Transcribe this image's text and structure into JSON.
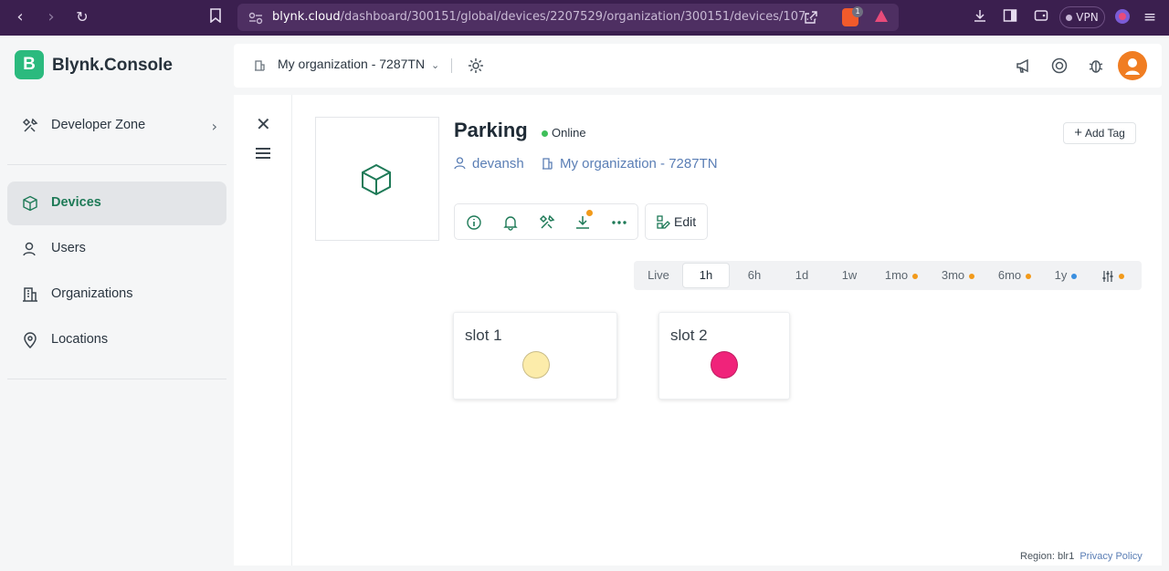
{
  "browser": {
    "url_host": "blynk.cloud",
    "url_path": "/dashboard/300151/global/devices/2207529/organization/300151/devices/107...",
    "vpn_label": "VPN",
    "brave_badge": "1"
  },
  "sidebar": {
    "logo_letter": "B",
    "logo_text": "Blynk.Console",
    "items": [
      {
        "label": "Developer Zone",
        "icon": "tools-icon"
      },
      {
        "label": "Devices",
        "icon": "cube-icon",
        "active": true
      },
      {
        "label": "Users",
        "icon": "user-icon"
      },
      {
        "label": "Organizations",
        "icon": "building-icon"
      },
      {
        "label": "Locations",
        "icon": "pin-icon"
      }
    ]
  },
  "header": {
    "org_label": "My organization - 7287TN"
  },
  "device": {
    "name": "Parking",
    "status": "Online",
    "owner": "devansh",
    "organization": "My organization - 7287TN",
    "add_tag_label": "Add Tag",
    "edit_label": "Edit"
  },
  "time_ranges": [
    {
      "label": "Live"
    },
    {
      "label": "1h",
      "active": true
    },
    {
      "label": "6h"
    },
    {
      "label": "1d"
    },
    {
      "label": "1w"
    },
    {
      "label": "1mo",
      "dot": "#f29a1a"
    },
    {
      "label": "3mo",
      "dot": "#f29a1a"
    },
    {
      "label": "6mo",
      "dot": "#f29a1a"
    },
    {
      "label": "1y",
      "dot": "#3a8fe0"
    }
  ],
  "widgets": [
    {
      "title": "slot 1",
      "led_color": "#fcecaa"
    },
    {
      "title": "slot 2",
      "led_color": "#f0237a"
    }
  ],
  "footer": {
    "region": "Region: blr1",
    "privacy": "Privacy Policy"
  },
  "colors": {
    "brand": "#2bba7e",
    "link": "#5a7eb5",
    "online": "#3fbf5a",
    "avatar": "#f07d22"
  }
}
